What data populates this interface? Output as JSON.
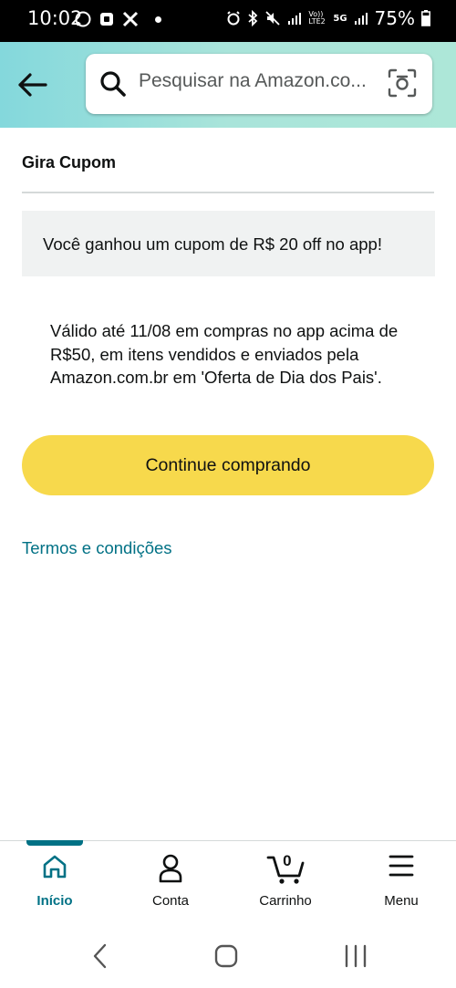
{
  "status_bar": {
    "time": "10:02",
    "battery": "75%",
    "network_5g": "5G",
    "volte": "Vo))\nLTE2"
  },
  "header": {
    "search_placeholder": "Pesquisar na Amazon.co..."
  },
  "page": {
    "title": "Gira Cupom",
    "coupon_message": "Você ganhou um cupom de R$ 20 off no app!",
    "validity_text": "Válido até 11/08 em compras no app acima de R$50, em itens vendidos e enviados pela Amazon.com.br em 'Oferta de Dia dos Pais'.",
    "continue_button": "Continue comprando",
    "terms_link": "Termos e condições"
  },
  "bottom_nav": {
    "items": [
      {
        "label": "Início",
        "icon": "home-icon",
        "active": true
      },
      {
        "label": "Conta",
        "icon": "person-icon",
        "active": false
      },
      {
        "label": "Carrinho",
        "icon": "cart-icon",
        "active": false
      },
      {
        "label": "Menu",
        "icon": "hamburger-menu-icon",
        "active": false
      }
    ],
    "cart_count": "0"
  },
  "colors": {
    "header_gradient_start": "#84d8dc",
    "header_gradient_end": "#ade7d8",
    "button_yellow": "#f7d94c",
    "link_teal": "#007185",
    "banner_gray": "#f0f2f2"
  }
}
